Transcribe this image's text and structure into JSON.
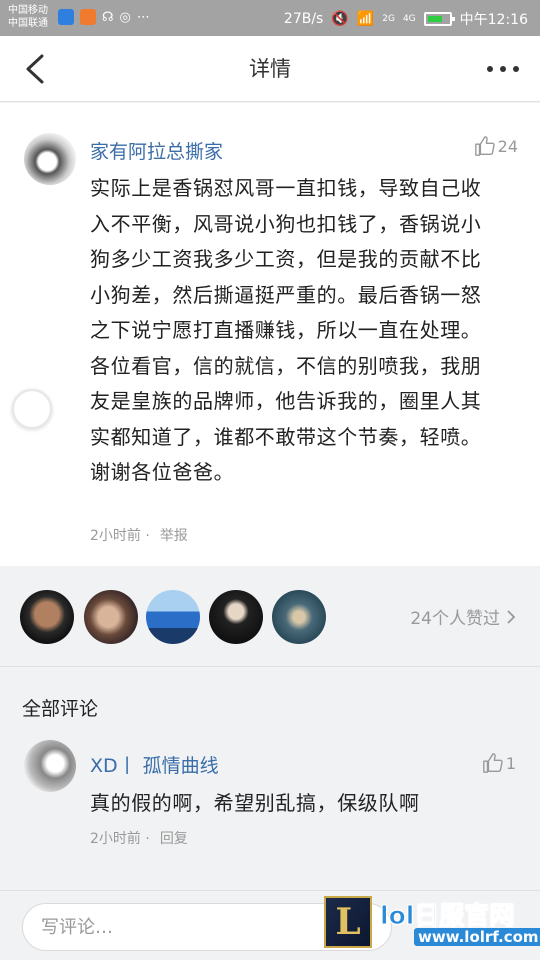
{
  "status_bar": {
    "carrier1": "中国移动",
    "carrier2": "中国联通",
    "speed": "27B/s",
    "signal1": "2G",
    "signal2": "4G",
    "time": "中午12:16"
  },
  "header": {
    "title": "详情"
  },
  "post": {
    "author": "家有阿拉总撕家",
    "likes": "24",
    "content": "实际上是香锅怼风哥一直扣钱，导致自己收入不平衡，风哥说小狗也扣钱了，香锅说小狗多少工资我多少工资，但是我的贡献不比小狗差，然后撕逼挺严重的。最后香锅一怒之下说宁愿打直播赚钱，所以一直在处理。各位看官，信的就信，不信的别喷我，我朋友是皇族的品牌师，他告诉我的，圈里人其实都知道了，谁都不敢带这个节奏，轻喷。谢谢各位爸爸。",
    "time": "2小时前 ·",
    "report": "举报"
  },
  "likers": {
    "count_text": "24个人赞过"
  },
  "comments": {
    "header": "全部评论",
    "items": [
      {
        "author": "XD丨 孤情曲线",
        "likes": "1",
        "text": "真的假的啊，希望别乱搞，保级队啊",
        "time": "2小时前 ·",
        "reply": "回复"
      }
    ]
  },
  "input": {
    "placeholder": "写评论…"
  },
  "watermark": {
    "logo_letter": "L",
    "title": "lol日服官网",
    "url": "www.lolrf.com"
  }
}
